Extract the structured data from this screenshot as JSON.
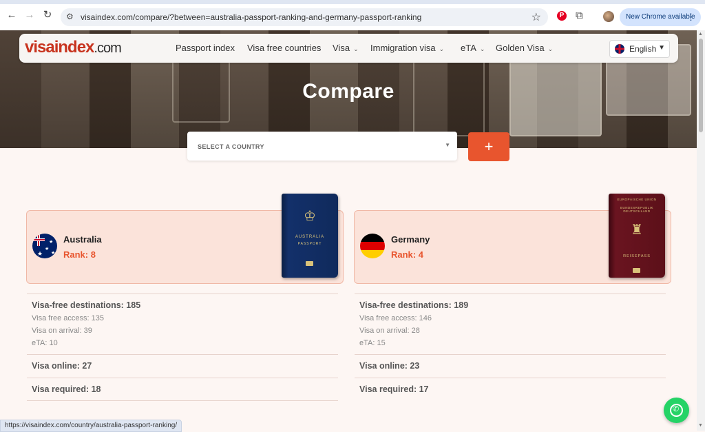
{
  "browser": {
    "url": "visaindex.com/compare/?between=australia-passport-ranking-and-germany-passport-ranking",
    "update_label": "New Chrome available",
    "status_url": "https://visaindex.com/country/australia-passport-ranking/"
  },
  "site": {
    "logo_main": "visaindex",
    "logo_tld": ".com",
    "nav": [
      {
        "label": "Passport index"
      },
      {
        "label": "Visa free countries"
      },
      {
        "label": "Visa"
      },
      {
        "label": "Immigration visa"
      },
      {
        "label": "eTA"
      },
      {
        "label": "Golden Visa"
      }
    ],
    "language": "English"
  },
  "hero": {
    "title": "Compare"
  },
  "selector": {
    "placeholder": "SELECT A COUNTRY",
    "add_label": "+"
  },
  "countries": [
    {
      "name": "Australia",
      "rank": "Rank: 8",
      "passport_line1": "AUSTRALIA",
      "passport_line2": "PASSPORT",
      "visa_free": "Visa-free destinations: 185",
      "visa_free_access": "Visa free access: 135",
      "visa_on_arrival": "Visa on arrival: 39",
      "eta": "eTA: 10",
      "visa_online": "Visa online: 27",
      "visa_required": "Visa required: 18"
    },
    {
      "name": "Germany",
      "rank": "Rank: 4",
      "passport_line1": "EUROPÄISCHE UNION",
      "passport_line2": "BUNDESREPUBLIK DEUTSCHLAND",
      "passport_line3": "REISEPASS",
      "visa_free": "Visa-free destinations: 189",
      "visa_free_access": "Visa free access: 146",
      "visa_on_arrival": "Visa on arrival: 28",
      "eta": "eTA: 15",
      "visa_online": "Visa online: 23",
      "visa_required": "Visa required: 17"
    }
  ]
}
